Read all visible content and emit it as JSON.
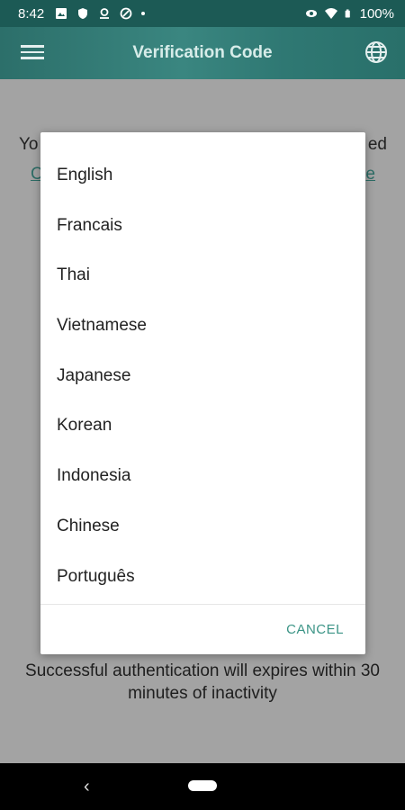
{
  "status_bar": {
    "time": "8:42",
    "battery": "100%"
  },
  "app_bar": {
    "title": "Verification Code"
  },
  "background": {
    "line1_left": "Yo",
    "line1_right": "ed",
    "line2_left": "C",
    "line2_right": "e",
    "footer": "Successful authentication will expires within 30 minutes of inactivity"
  },
  "language_dialog": {
    "options": [
      "English",
      "Francais",
      "Thai",
      "Vietnamese",
      "Japanese",
      "Korean",
      "Indonesia",
      "Chinese",
      "Português"
    ],
    "cancel_label": "CANCEL"
  },
  "colors": {
    "accent": "#3b9486",
    "app_bar": "#2c6f6a"
  }
}
